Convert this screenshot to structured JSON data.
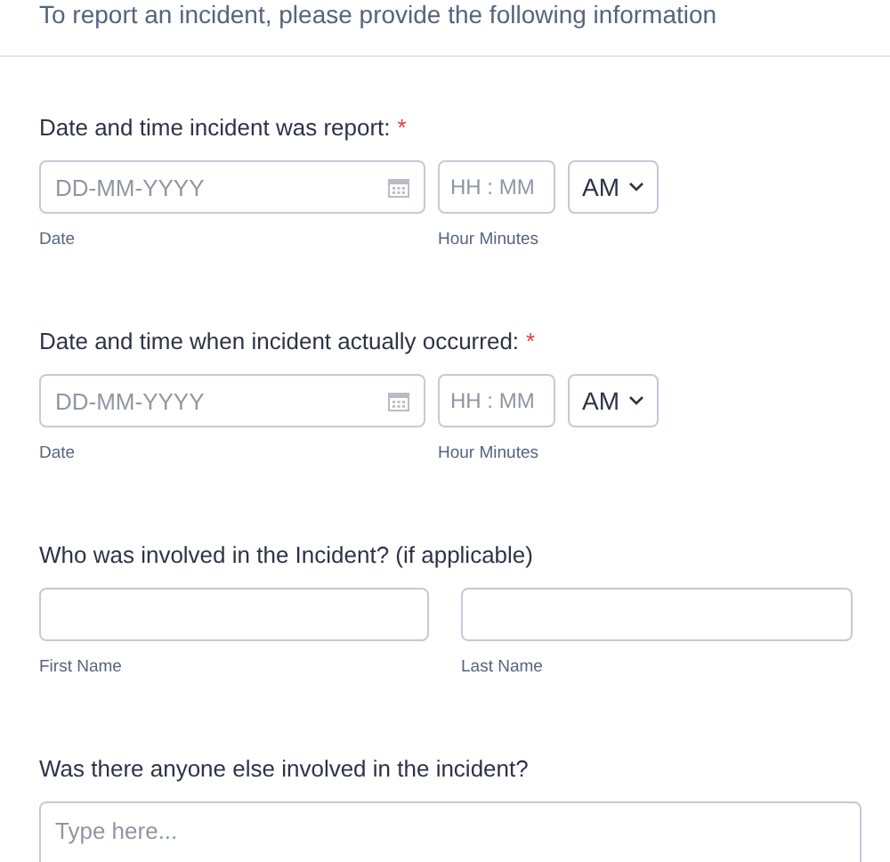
{
  "intro": "To report an incident, please provide the following information",
  "sections": [
    {
      "kind": "datetime",
      "label": "Date and time incident was report:",
      "required_mark": "*",
      "date_placeholder": "DD-MM-YYYY",
      "time_placeholder": "HH : MM",
      "ampm": "AM",
      "date_caption": "Date",
      "time_caption": "Hour Minutes"
    },
    {
      "kind": "datetime",
      "label": "Date and time when incident actually occurred:",
      "required_mark": "*",
      "date_placeholder": "DD-MM-YYYY",
      "time_placeholder": "HH : MM",
      "ampm": "AM",
      "date_caption": "Date",
      "time_caption": "Hour Minutes"
    },
    {
      "kind": "name",
      "label": "Who was involved in the Incident? (if applicable)",
      "first_caption": "First Name",
      "last_caption": "Last Name"
    },
    {
      "kind": "textarea",
      "label": "Was there anyone else involved in the incident?",
      "placeholder": "Type here..."
    }
  ]
}
